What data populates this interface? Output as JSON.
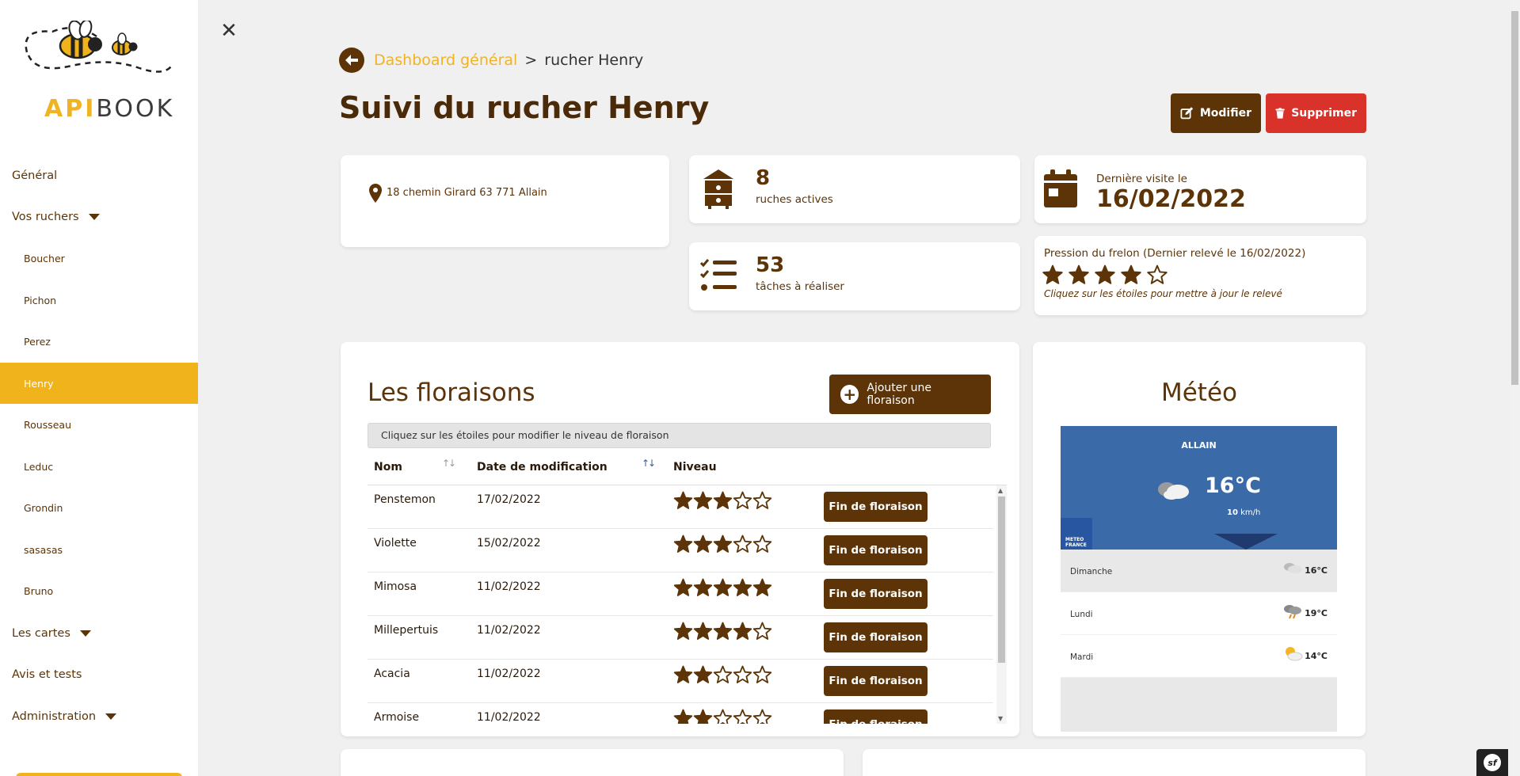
{
  "logo": {
    "api": "API",
    "book": "BOOK"
  },
  "sidebar": {
    "items": [
      {
        "label": "Général",
        "type": "top"
      },
      {
        "label": "Vos ruchers",
        "type": "top",
        "caret": true
      },
      {
        "label": "Boucher",
        "type": "sub"
      },
      {
        "label": "Pichon",
        "type": "sub"
      },
      {
        "label": "Perez",
        "type": "sub"
      },
      {
        "label": "Henry",
        "type": "sub",
        "active": true
      },
      {
        "label": "Rousseau",
        "type": "sub"
      },
      {
        "label": "Leduc",
        "type": "sub"
      },
      {
        "label": "Grondin",
        "type": "sub"
      },
      {
        "label": "sasasas",
        "type": "sub"
      },
      {
        "label": "Bruno",
        "type": "sub"
      },
      {
        "label": "Les cartes",
        "type": "top",
        "caret": true
      },
      {
        "label": "Avis et tests",
        "type": "top"
      },
      {
        "label": "Administration",
        "type": "top",
        "caret": true
      }
    ]
  },
  "breadcrumb": {
    "link": "Dashboard général",
    "separator": ">",
    "current": "rucher Henry"
  },
  "header": {
    "title_prefix": "Suivi du rucher ",
    "title_name": "Henry"
  },
  "actions": {
    "modify": "Modifier",
    "delete": "Supprimer"
  },
  "stats": {
    "address": "18 chemin Girard 63 771 Allain",
    "ruches_count": "8",
    "ruches_label": "ruches actives",
    "taches_count": "53",
    "taches_label": "tâches à réaliser",
    "visite_label": "Dernière visite le",
    "visite_date": "16/02/2022",
    "frelon_title": "Pression du frelon (Dernier relevé le 16/02/2022)",
    "frelon_level": 4,
    "frelon_hint": "Cliquez sur les étoiles pour mettre à jour le relevé"
  },
  "floraisons": {
    "title": "Les floraisons",
    "add_button": "Ajouter une floraison",
    "hint": "Cliquez sur les étoiles pour modifier le niveau de floraison",
    "columns": {
      "name": "Nom",
      "date": "Date de modification",
      "level": "Niveau"
    },
    "end_label": "Fin de floraison",
    "rows": [
      {
        "name": "Penstemon",
        "date": "17/02/2022",
        "level": 3
      },
      {
        "name": "Violette",
        "date": "15/02/2022",
        "level": 3
      },
      {
        "name": "Mimosa",
        "date": "11/02/2022",
        "level": 5
      },
      {
        "name": "Millepertuis",
        "date": "11/02/2022",
        "level": 4
      },
      {
        "name": "Acacia",
        "date": "11/02/2022",
        "level": 2
      },
      {
        "name": "Armoise",
        "date": "11/02/2022",
        "level": 2
      }
    ]
  },
  "meteo": {
    "title": "Météo",
    "city": "ALLAIN",
    "temperature": "16°C",
    "wind_value": "10",
    "wind_unit": " km/h",
    "brand": "METEO FRANCE",
    "days": [
      {
        "day": "Dimanche",
        "temp": "16°C",
        "icon": "cloudy-icon"
      },
      {
        "day": "Lundi",
        "temp": "19°C",
        "icon": "rain-cloud-icon"
      },
      {
        "day": "Mardi",
        "temp": "14°C",
        "icon": "sun-cloud-icon"
      }
    ]
  },
  "colors": {
    "brand_brown": "#5c3408",
    "accent_yellow": "#f1b31c",
    "danger_red": "#d9322b",
    "meteo_blue": "#3a6aa8"
  }
}
